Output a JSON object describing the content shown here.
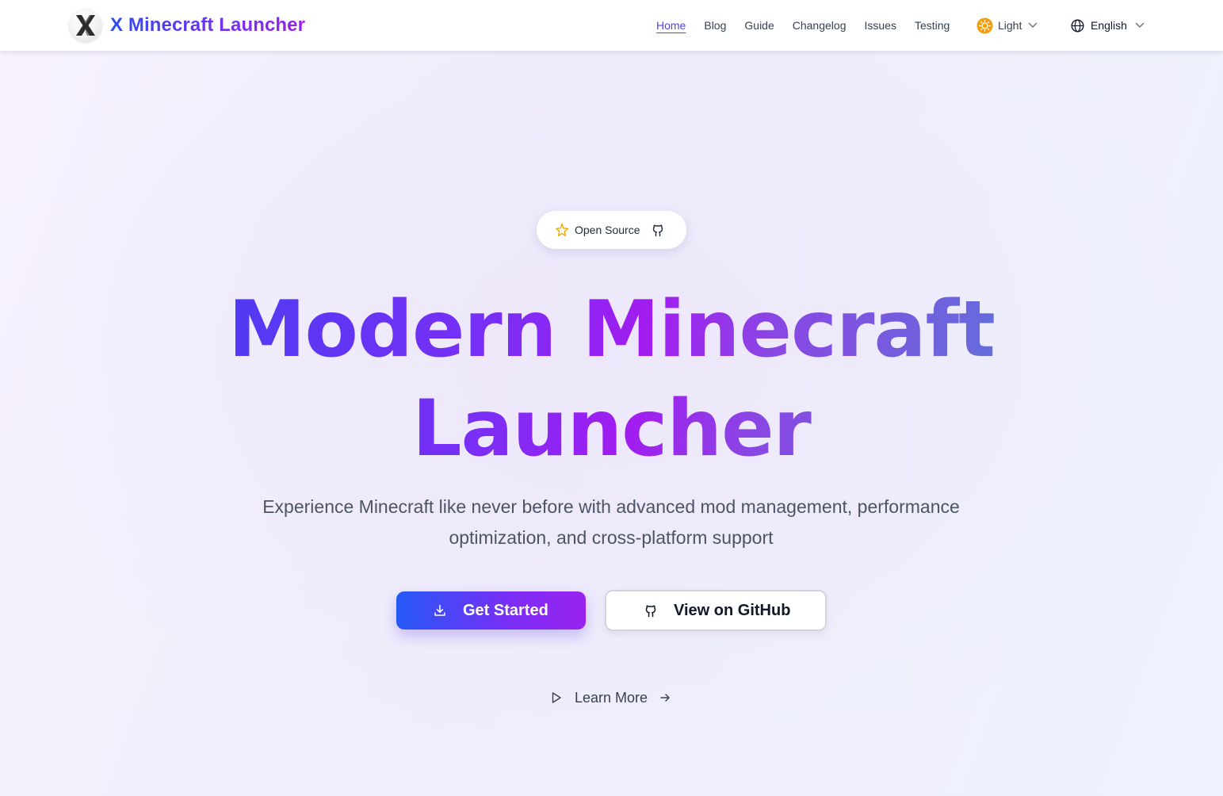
{
  "header": {
    "brand": "X Minecraft Launcher",
    "logo_letter": "X",
    "nav": [
      {
        "label": "Home",
        "active": true
      },
      {
        "label": "Blog"
      },
      {
        "label": "Guide"
      },
      {
        "label": "Changelog"
      },
      {
        "label": "Issues"
      },
      {
        "label": "Testing"
      }
    ],
    "theme_select": {
      "value": "Light",
      "icon": "sun-icon"
    },
    "language_select": {
      "value": "English",
      "icon": "globe-icon"
    }
  },
  "hero": {
    "badge": {
      "label": "Open Source",
      "icon_left": "sparkle-icon",
      "icon_right": "github-icon"
    },
    "headline_line1": "Modern Minecraft",
    "headline_line2": "Launcher",
    "subtitle": "Experience Minecraft like never before with advanced mod management, performance optimization, and cross-platform support",
    "primary_button": {
      "label": "Get Started",
      "icon": "download-icon"
    },
    "secondary_button": {
      "label": "View on GitHub",
      "icon": "github-icon"
    },
    "learn_more": {
      "label": "Learn More",
      "icon_left": "play-icon",
      "icon_right": "arrow-right-icon"
    }
  },
  "colors": {
    "accent": "#4f46e5",
    "gradient_start": "#2459f5",
    "gradient_end": "#9a22f0",
    "sun": "#f59e0b"
  }
}
